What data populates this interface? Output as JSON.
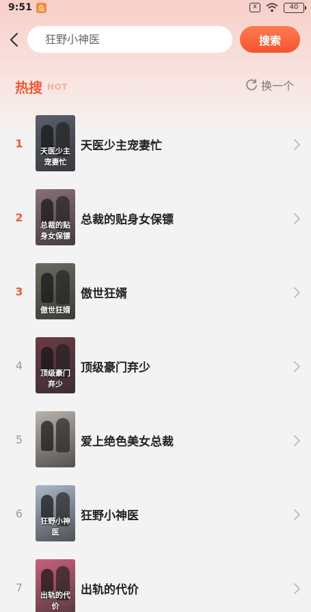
{
  "status_bar": {
    "time": "9:51",
    "badge": "岛",
    "sim_label": "x",
    "battery": "40"
  },
  "search": {
    "placeholder": "狂野小神医",
    "button_label": "搜索"
  },
  "hot_section": {
    "title": "热搜",
    "title_en": "HOT",
    "refresh_label": "换一个"
  },
  "colors": {
    "accent": "#ee5a34",
    "top_rank": "#ee5a34",
    "other_rank": "#9a9a9a"
  },
  "items": [
    {
      "rank": "1",
      "title": "天医少主宠妻忙",
      "cover_text": "天医少主宠妻忙",
      "cover_color": "#5a5f6b"
    },
    {
      "rank": "2",
      "title": "总裁的贴身女保镖",
      "cover_text": "总裁的贴身女保镖",
      "cover_color": "#8a6f78"
    },
    {
      "rank": "3",
      "title": "傲世狂婿",
      "cover_text": "傲世狂婿",
      "cover_color": "#6b6a5e"
    },
    {
      "rank": "4",
      "title": "顶级豪门弃少",
      "cover_text": "顶级豪门弃少",
      "cover_color": "#6a3a46"
    },
    {
      "rank": "5",
      "title": "爱上绝色美女总裁",
      "cover_text": "",
      "cover_color": "#b9b2ad"
    },
    {
      "rank": "6",
      "title": "狂野小神医",
      "cover_text": "狂野小神医",
      "cover_color": "#a9b7c7"
    },
    {
      "rank": "7",
      "title": "出轨的代价",
      "cover_text": "出轨的代价",
      "cover_color": "#c95f7a"
    }
  ]
}
